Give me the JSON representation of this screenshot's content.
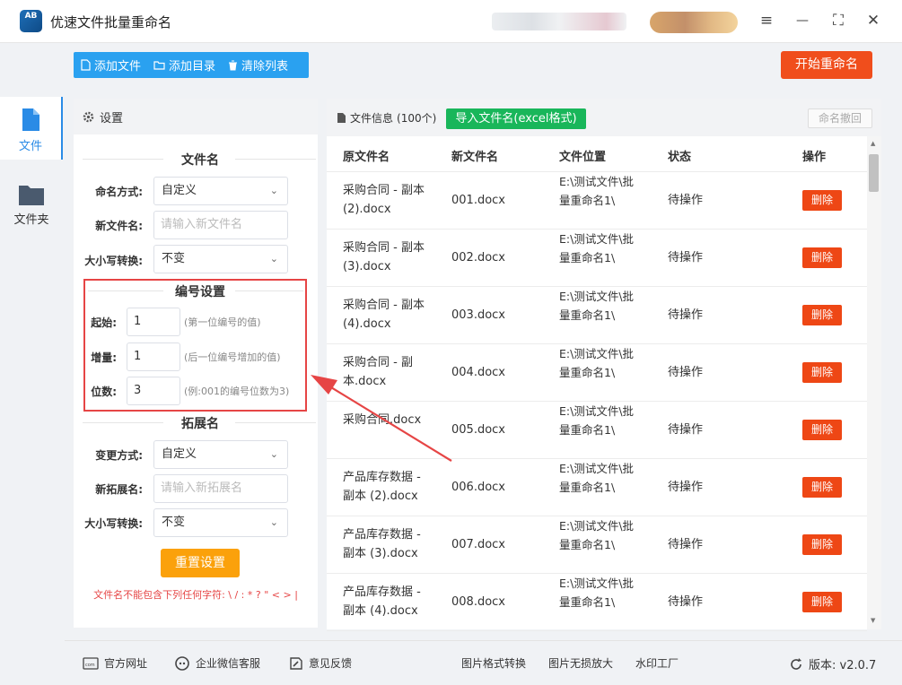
{
  "app": {
    "title": "优速文件批量重命名",
    "logo_text": "AB"
  },
  "window_controls": {
    "menu": "≡",
    "minimize": "—",
    "maximize": "⛶",
    "close": "✕"
  },
  "toolbar": {
    "add_file": "添加文件",
    "add_dir": "添加目录",
    "clear_list": "清除列表",
    "start": "开始重命名"
  },
  "nav": {
    "file": "文件",
    "folder": "文件夹"
  },
  "settings": {
    "header": "设置",
    "filename": {
      "title": "文件名",
      "mode_label": "命名方式:",
      "mode_value": "自定义",
      "newname_label": "新文件名:",
      "newname_placeholder": "请输入新文件名",
      "case_label": "大小写转换:",
      "case_value": "不变"
    },
    "numbering": {
      "title": "编号设置",
      "start_label": "起始:",
      "start_value": "1",
      "start_hint": "(第一位编号的值)",
      "inc_label": "增量:",
      "inc_value": "1",
      "inc_hint": "(后一位编号增加的值)",
      "digits_label": "位数:",
      "digits_value": "3",
      "digits_hint": "(例:001的编号位数为3)"
    },
    "extension": {
      "title": "拓展名",
      "mode_label": "变更方式:",
      "mode_value": "自定义",
      "newext_label": "新拓展名:",
      "newext_placeholder": "请输入新拓展名",
      "case_label": "大小写转换:",
      "case_value": "不变"
    },
    "reset": "重置设置",
    "warning": "文件名不能包含下列任何字符: \\ / : * ? \" < > |"
  },
  "files": {
    "title": "文件信息",
    "count": "(100个)",
    "import": "导入文件名(excel格式)",
    "undo": "命名撤回",
    "columns": [
      "原文件名",
      "新文件名",
      "文件位置",
      "状态",
      "操作"
    ],
    "rows": [
      {
        "orig": "采购合同 - 副本 (2).docx",
        "new": "001.docx",
        "loc": "E:\\测试文件\\批量重命名1\\",
        "status": "待操作",
        "action": "删除"
      },
      {
        "orig": "采购合同 - 副本 (3).docx",
        "new": "002.docx",
        "loc": "E:\\测试文件\\批量重命名1\\",
        "status": "待操作",
        "action": "删除"
      },
      {
        "orig": "采购合同 - 副本 (4).docx",
        "new": "003.docx",
        "loc": "E:\\测试文件\\批量重命名1\\",
        "status": "待操作",
        "action": "删除"
      },
      {
        "orig": "采购合同 - 副本.docx",
        "new": "004.docx",
        "loc": "E:\\测试文件\\批量重命名1\\",
        "status": "待操作",
        "action": "删除"
      },
      {
        "orig": "采购合同.docx",
        "new": "005.docx",
        "loc": "E:\\测试文件\\批量重命名1\\",
        "status": "待操作",
        "action": "删除"
      },
      {
        "orig": "产品库存数据 - 副本 (2).docx",
        "new": "006.docx",
        "loc": "E:\\测试文件\\批量重命名1\\",
        "status": "待操作",
        "action": "删除"
      },
      {
        "orig": "产品库存数据 - 副本 (3).docx",
        "new": "007.docx",
        "loc": "E:\\测试文件\\批量重命名1\\",
        "status": "待操作",
        "action": "删除"
      },
      {
        "orig": "产品库存数据 - 副本 (4).docx",
        "new": "008.docx",
        "loc": "E:\\测试文件\\批量重命名1\\",
        "status": "待操作",
        "action": "删除"
      }
    ]
  },
  "footer": {
    "website": "官方网址",
    "wechat": "企业微信客服",
    "feedback": "意见反馈",
    "format": "图片格式转换",
    "enlarge": "图片无损放大",
    "watermark": "水印工厂",
    "version": "版本: v2.0.7"
  },
  "colors": {
    "accent_blue": "#2aa1f0",
    "start_orange": "#f04e1c",
    "import_green": "#19b65a",
    "reset_orange": "#fba10b",
    "delete_red": "#ee4715",
    "highlight_red": "#e64545"
  }
}
